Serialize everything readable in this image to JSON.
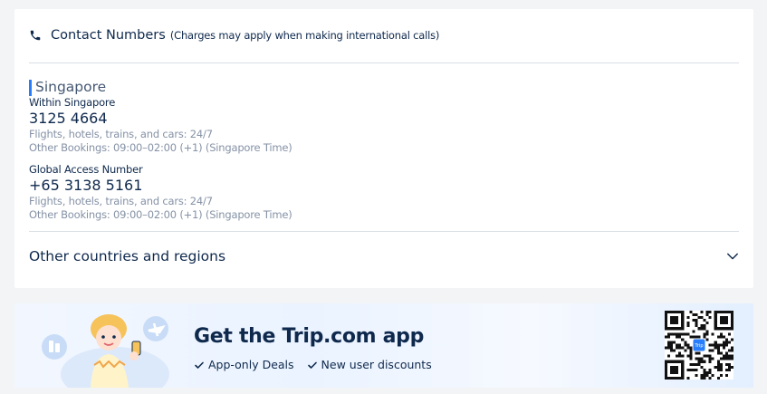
{
  "contact": {
    "title": "Contact Numbers",
    "note": "(Charges may apply when making international calls)",
    "icon": "phone-icon"
  },
  "region": {
    "name": "Singapore",
    "accent": "#287dfa"
  },
  "entries": [
    {
      "label": "Within Singapore",
      "number": "3125 4664",
      "line1": "Flights, hotels, trains, and cars: 24/7",
      "line2": "Other Bookings: 09:00–02:00 (+1) (Singapore Time)"
    },
    {
      "label": "Global Access Number",
      "number": "+65 3138 5161",
      "line1": "Flights, hotels, trains, and cars: 24/7",
      "line2": "Other Bookings: 09:00–02:00 (+1) (Singapore Time)"
    }
  ],
  "other": {
    "label": "Other countries and regions",
    "icon": "chevron-down-icon"
  },
  "banner": {
    "title": "Get the Trip.com app",
    "perks": [
      "App-only Deals",
      "New user discounts"
    ],
    "qr_badge": "Trip",
    "accent": "#287dfa"
  }
}
